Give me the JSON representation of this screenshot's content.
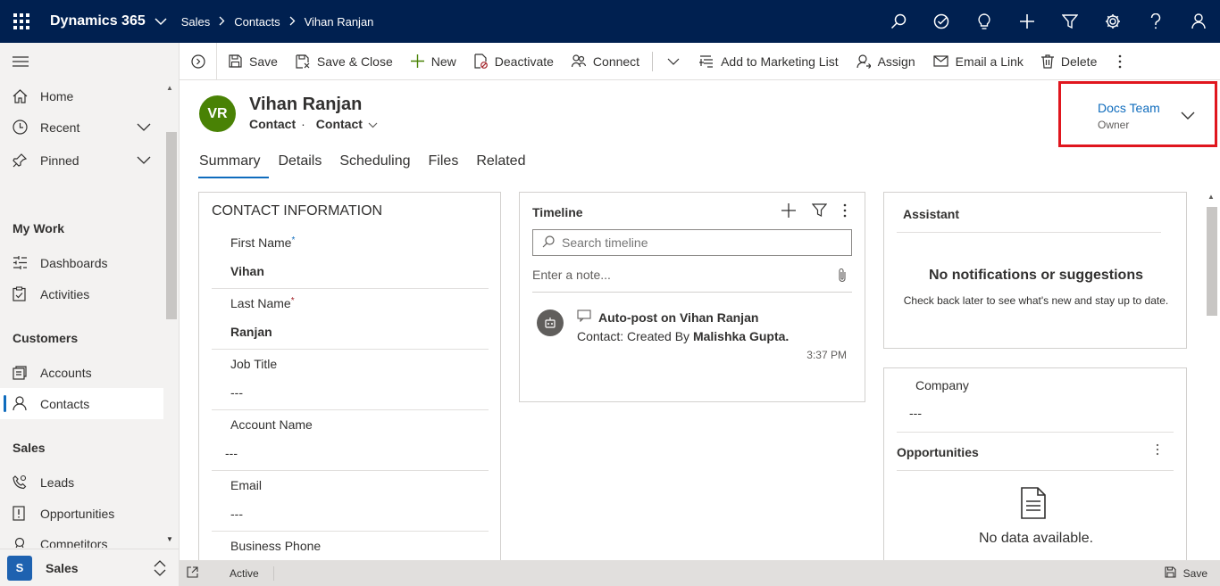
{
  "topbar": {
    "app_name": "Dynamics 365",
    "breadcrumb": [
      "Sales",
      "Contacts",
      "Vihan Ranjan"
    ],
    "icons": [
      "search-icon",
      "task-icon",
      "lightbulb-icon",
      "plus-icon",
      "filter-icon",
      "settings-icon",
      "help-icon",
      "user-icon"
    ]
  },
  "sidebar": {
    "items": [
      {
        "label": "Home",
        "icon": "home-icon"
      },
      {
        "label": "Recent",
        "icon": "clock-icon",
        "expandable": true
      },
      {
        "label": "Pinned",
        "icon": "pin-icon",
        "expandable": true
      }
    ],
    "groups": [
      {
        "title": "My Work",
        "items": [
          {
            "label": "Dashboards",
            "icon": "dashboard-icon"
          },
          {
            "label": "Activities",
            "icon": "activities-icon"
          }
        ]
      },
      {
        "title": "Customers",
        "items": [
          {
            "label": "Accounts",
            "icon": "accounts-icon"
          },
          {
            "label": "Contacts",
            "icon": "contact-icon",
            "active": true
          }
        ]
      },
      {
        "title": "Sales",
        "items": [
          {
            "label": "Leads",
            "icon": "leads-icon"
          },
          {
            "label": "Opportunities",
            "icon": "opportunities-icon"
          },
          {
            "label": "Competitors",
            "icon": "competitors-icon"
          }
        ]
      }
    ],
    "area": {
      "badge": "S",
      "label": "Sales"
    }
  },
  "commands": {
    "save": "Save",
    "save_close": "Save & Close",
    "new": "New",
    "deactivate": "Deactivate",
    "connect": "Connect",
    "add_marketing": "Add to Marketing List",
    "assign": "Assign",
    "email_link": "Email a Link",
    "delete": "Delete"
  },
  "record": {
    "initials": "VR",
    "name": "Vihan Ranjan",
    "entity": "Contact",
    "form": "Contact",
    "owner_name": "Docs Team",
    "owner_label": "Owner",
    "avatar_color": "#498205"
  },
  "tabs": [
    "Summary",
    "Details",
    "Scheduling",
    "Files",
    "Related"
  ],
  "contact_info": {
    "title": "CONTACT INFORMATION",
    "fields": [
      {
        "label": "First Name",
        "value": "Vihan",
        "marker": "*"
      },
      {
        "label": "Last Name",
        "value": "Ranjan",
        "marker": "*"
      },
      {
        "label": "Job Title",
        "value": "---"
      },
      {
        "label": "Account Name",
        "value": "---"
      },
      {
        "label": "Email",
        "value": "---"
      },
      {
        "label": "Business Phone",
        "value": ""
      }
    ]
  },
  "timeline": {
    "title": "Timeline",
    "search_placeholder": "Search timeline",
    "note_placeholder": "Enter a note...",
    "post_title": "Auto-post on Vihan Ranjan",
    "post_body_prefix": "Contact: Created By ",
    "post_body_user": "Malishka Gupta.",
    "post_time": "3:37 PM"
  },
  "assistant": {
    "title": "Assistant",
    "main": "No notifications or suggestions",
    "sub": "Check back later to see what's new and stay up to date."
  },
  "side_card": {
    "company_label": "Company",
    "company_value": "---",
    "opportunities_title": "Opportunities",
    "empty_text": "No data available."
  },
  "status": {
    "state": "Active",
    "save_label": "Save"
  },
  "colors": {
    "topbar": "#002050",
    "accent": "#0f6cbd",
    "highlight_border": "#e0161e"
  }
}
